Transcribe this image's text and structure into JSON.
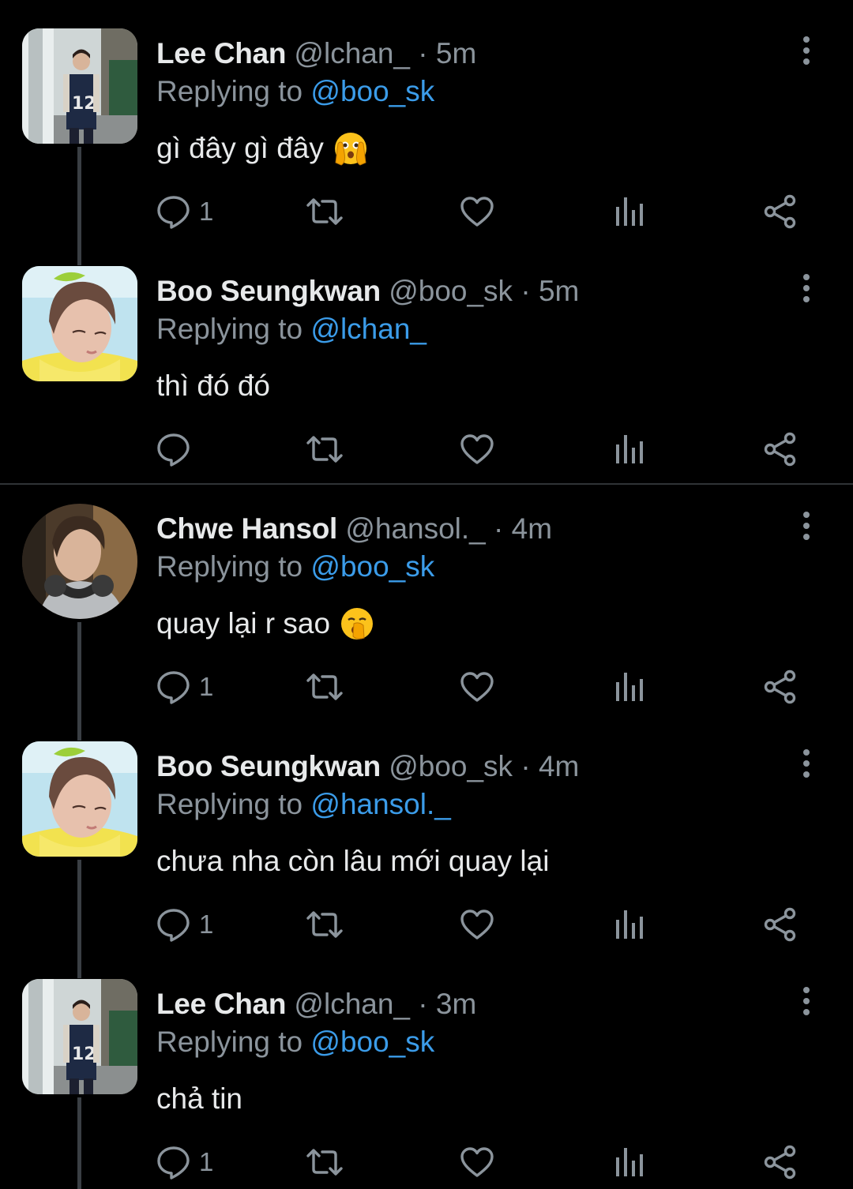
{
  "labels": {
    "replying_prefix": "Replying to",
    "separator": "·"
  },
  "colors": {
    "background": "#000000",
    "text": "#e7e9ea",
    "muted": "#8b949c",
    "mention": "#3b9ce9"
  },
  "tweets": [
    {
      "name": "Lee Chan",
      "handle": "@lchan_",
      "time": "5m",
      "replying_to": "@boo_sk",
      "text": "gì đây gì đây",
      "emoji": "face-with-open-eyes-and-hand-over-mouth",
      "reply_count": "1",
      "avatar": "lee-chan-avatar"
    },
    {
      "name": "Boo Seungkwan",
      "handle": "@boo_sk",
      "time": "5m",
      "replying_to": "@lchan_",
      "text": "thì đó đó",
      "emoji": "",
      "reply_count": "",
      "avatar": "boo-seungkwan-avatar"
    },
    {
      "name": "Chwe Hansol",
      "handle": "@hansol._",
      "time": "4m",
      "replying_to": "@boo_sk",
      "text": "quay lại r sao",
      "emoji": "yawning-face",
      "reply_count": "1",
      "avatar": "chwe-hansol-avatar"
    },
    {
      "name": "Boo Seungkwan",
      "handle": "@boo_sk",
      "time": "4m",
      "replying_to": "@hansol._",
      "text": "chưa nha còn lâu mới quay lại",
      "emoji": "",
      "reply_count": "1",
      "avatar": "boo-seungkwan-avatar"
    },
    {
      "name": "Lee Chan",
      "handle": "@lchan_",
      "time": "3m",
      "replying_to": "@boo_sk",
      "text": "chả tin",
      "emoji": "",
      "reply_count": "1",
      "avatar": "lee-chan-avatar"
    }
  ]
}
